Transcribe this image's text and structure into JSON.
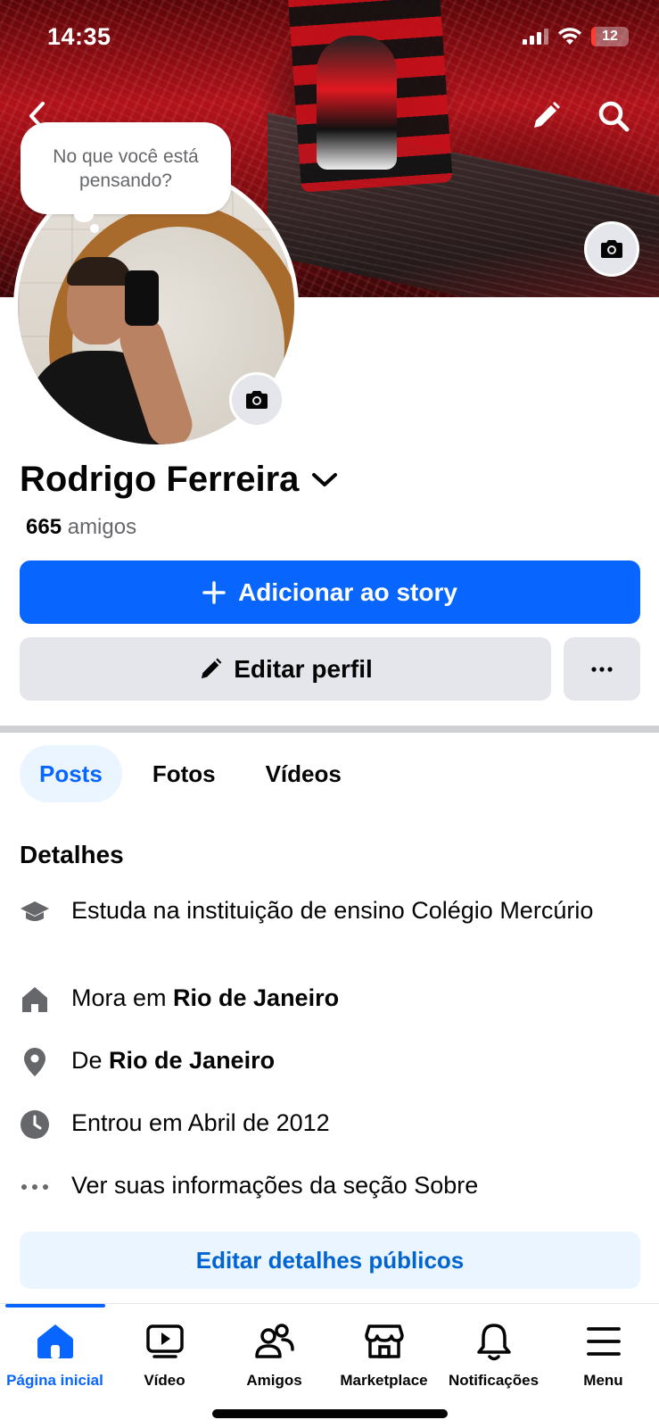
{
  "status_bar": {
    "time": "14:35",
    "battery": "12"
  },
  "composer": {
    "prompt": "No que você está pensando?"
  },
  "profile": {
    "name": "Rodrigo Ferreira",
    "friends_count": "665",
    "friends_label": "amigos"
  },
  "actions": {
    "add_story": "Adicionar ao story",
    "edit_profile": "Editar perfil"
  },
  "tabs": [
    {
      "label": "Posts",
      "active": true
    },
    {
      "label": "Fotos",
      "active": false
    },
    {
      "label": "Vídeos",
      "active": false
    }
  ],
  "details": {
    "title": "Detalhes",
    "items": [
      {
        "icon": "graduation-cap-icon",
        "prefix": "Estuda na instituição de ensino Colégio Mercúrio",
        "bold": ""
      },
      {
        "icon": "home-icon",
        "prefix": "Mora em ",
        "bold": "Rio de Janeiro"
      },
      {
        "icon": "location-pin-icon",
        "prefix": "De ",
        "bold": "Rio de Janeiro"
      },
      {
        "icon": "clock-icon",
        "prefix": "Entrou em Abril de 2012",
        "bold": ""
      },
      {
        "icon": "more-dots-icon",
        "prefix": "Ver suas informações da seção Sobre",
        "bold": ""
      }
    ],
    "edit_public": "Editar detalhes públicos"
  },
  "bottom_nav": [
    {
      "label": "Página inicial",
      "icon": "home-icon",
      "active": true
    },
    {
      "label": "Vídeo",
      "icon": "video-icon",
      "active": false
    },
    {
      "label": "Amigos",
      "icon": "friends-icon",
      "active": false
    },
    {
      "label": "Marketplace",
      "icon": "marketplace-icon",
      "active": false
    },
    {
      "label": "Notificações",
      "icon": "bell-icon",
      "active": false
    },
    {
      "label": "Menu",
      "icon": "menu-icon",
      "active": false
    }
  ],
  "colors": {
    "accent": "#0866ff",
    "secondary_button": "#e4e6eb",
    "muted_text": "#65676b"
  }
}
